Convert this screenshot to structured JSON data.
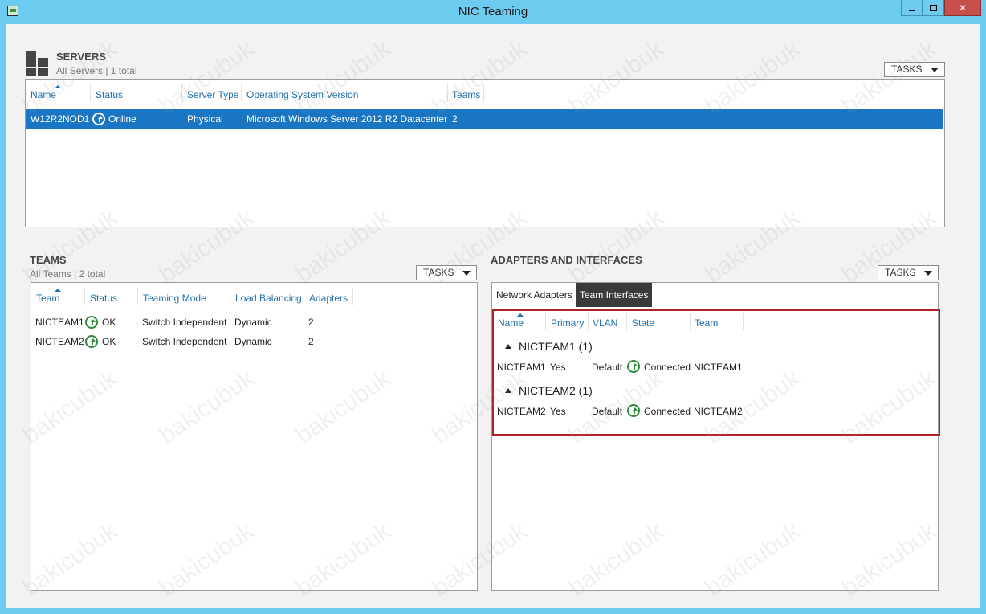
{
  "window": {
    "title": "NIC Teaming",
    "controls": {
      "minimize": "minimize-icon",
      "maximize": "maximize-icon",
      "close": "✕"
    }
  },
  "servers": {
    "title": "SERVERS",
    "subtitle": "All Servers | 1 total",
    "tasks_label": "TASKS",
    "columns": [
      "Name",
      "Status",
      "Server Type",
      "Operating System Version",
      "Teams"
    ],
    "rows": [
      {
        "name": "W12R2NOD1",
        "status": "Online",
        "server_type": "Physical",
        "os_version": "Microsoft Windows Server 2012 R2 Datacenter",
        "teams": "2",
        "selected": true
      }
    ]
  },
  "teams": {
    "title": "TEAMS",
    "subtitle": "All Teams | 2 total",
    "tasks_label": "TASKS",
    "columns": [
      "Team",
      "Status",
      "Teaming Mode",
      "Load Balancing",
      "Adapters"
    ],
    "rows": [
      {
        "team": "NICTEAM1",
        "status": "OK",
        "teaming_mode": "Switch Independent",
        "load_balancing": "Dynamic",
        "adapters": "2"
      },
      {
        "team": "NICTEAM2",
        "status": "OK",
        "teaming_mode": "Switch Independent",
        "load_balancing": "Dynamic",
        "adapters": "2"
      }
    ]
  },
  "adapters": {
    "title": "ADAPTERS AND INTERFACES",
    "tasks_label": "TASKS",
    "tabs": [
      {
        "label": "Network Adapters",
        "active": false
      },
      {
        "label": "Team Interfaces",
        "active": true
      }
    ],
    "columns": [
      "Name",
      "Primary",
      "VLAN",
      "State",
      "Team"
    ],
    "groups": [
      {
        "label": "NICTEAM1 (1)",
        "rows": [
          {
            "name": "NICTEAM1",
            "primary": "Yes",
            "vlan": "Default",
            "state": "Connected",
            "team": "NICTEAM1"
          }
        ]
      },
      {
        "label": "NICTEAM2 (1)",
        "rows": [
          {
            "name": "NICTEAM2",
            "primary": "Yes",
            "vlan": "Default",
            "state": "Connected",
            "team": "NICTEAM2"
          }
        ]
      }
    ]
  },
  "watermark": "bakicubuk",
  "colors": {
    "titlebar": "#6ccbef",
    "selection": "#1a75c2",
    "header_text": "#1f6fa8",
    "status_green": "#2e8b3a",
    "highlight_border": "#b0222a"
  }
}
